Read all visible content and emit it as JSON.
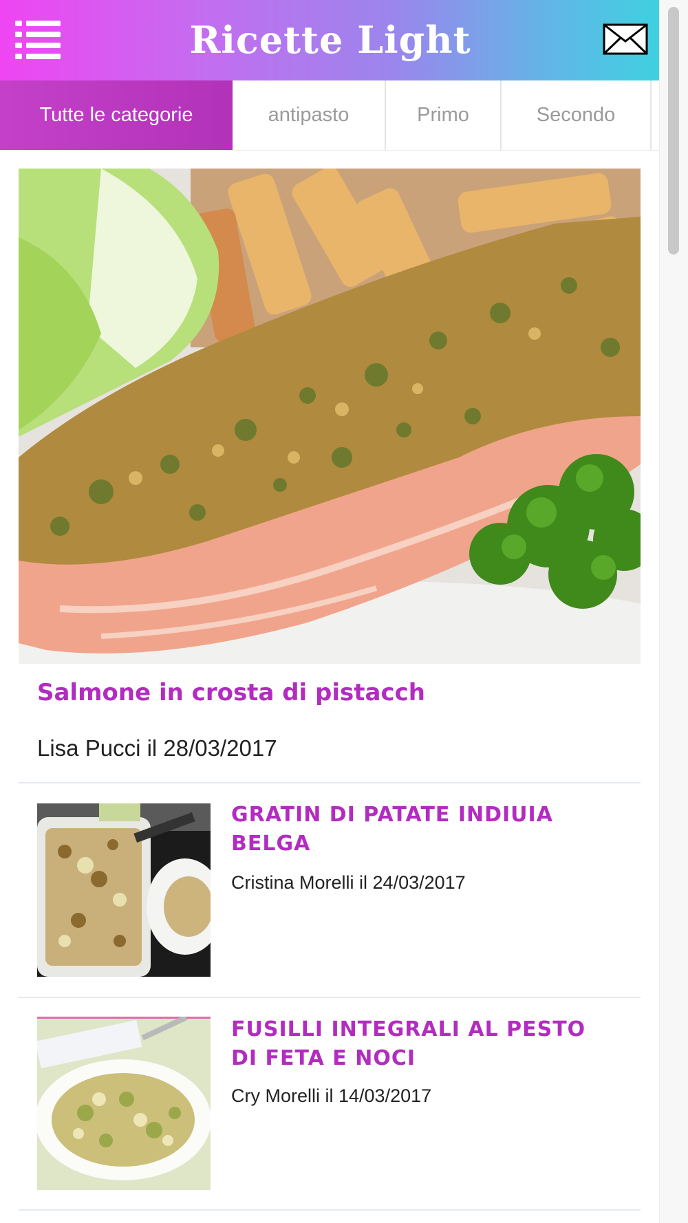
{
  "header": {
    "title": "Ricette Light",
    "menu_icon": "hamburger-menu-icon",
    "mail_icon": "envelope-icon",
    "gradient_start": "#ef45f2",
    "gradient_end": "#3fd0e0"
  },
  "tabs": [
    {
      "label": "Tutte le categorie",
      "active": true
    },
    {
      "label": "antipasto",
      "active": false
    },
    {
      "label": "Primo",
      "active": false
    },
    {
      "label": "Secondo",
      "active": false
    }
  ],
  "featured": {
    "title": "Salmone in crosta di pistacch",
    "meta": "Lisa Pucci il 28/03/2017"
  },
  "recipes": [
    {
      "title": "GRATIN DI PATATE INDIUIA BELGA",
      "meta": "Cristina Morelli il 24/03/2017"
    },
    {
      "title": "FUSILLI INTEGRALI AL PESTO DI FETA E NOCI",
      "meta": "Cry Morelli il 14/03/2017"
    }
  ],
  "colors": {
    "accent": "#b22cc0",
    "active_tab": "#c440c8"
  }
}
